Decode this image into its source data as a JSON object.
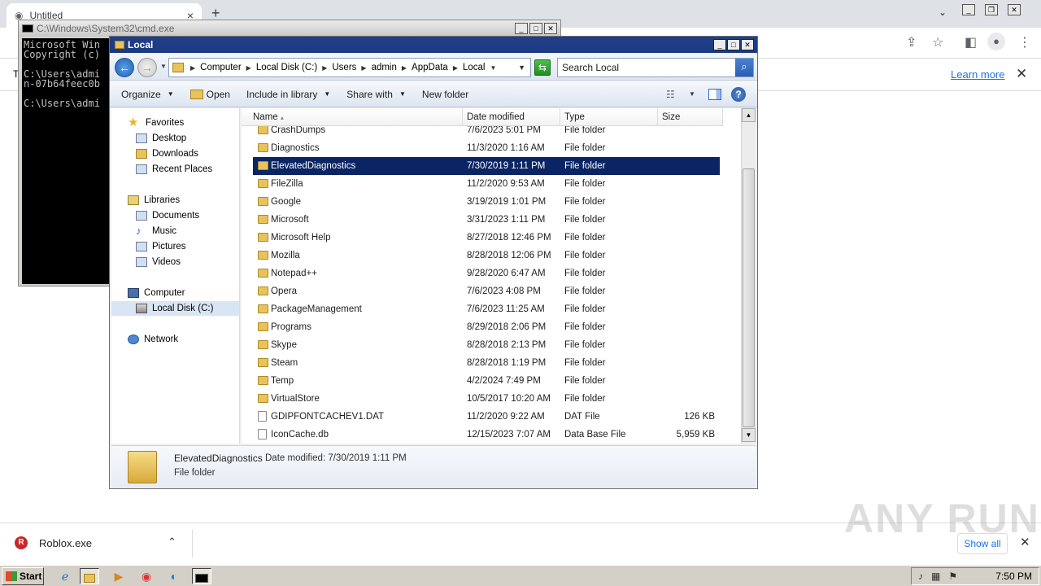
{
  "browser": {
    "tab_title": "Untitled",
    "tab_close": "×",
    "new_tab": "+",
    "infobar_letter": "T",
    "learn_more": "Learn more",
    "close": "✕"
  },
  "cmd": {
    "title": "C:\\Windows\\System32\\cmd.exe",
    "lines": "Microsoft Win\nCopyright (c)\n\nC:\\Users\\admi\nn-07b64feec0b\n\nC:\\Users\\admi"
  },
  "explorer": {
    "title": "Local",
    "breadcrumbs": [
      "Computer",
      "Local Disk (C:)",
      "Users",
      "admin",
      "AppData",
      "Local"
    ],
    "search_placeholder": "Search Local",
    "toolbar": {
      "organize": "Organize",
      "open": "Open",
      "include": "Include in library",
      "share": "Share with",
      "new_folder": "New folder"
    },
    "nav": {
      "favorites": "Favorites",
      "desktop": "Desktop",
      "downloads": "Downloads",
      "recent": "Recent Places",
      "libraries": "Libraries",
      "documents": "Documents",
      "music": "Music",
      "pictures": "Pictures",
      "videos": "Videos",
      "computer": "Computer",
      "local_disk": "Local Disk (C:)",
      "network": "Network"
    },
    "columns": {
      "name": "Name",
      "date": "Date modified",
      "type": "Type",
      "size": "Size"
    },
    "files": [
      {
        "name": "CrashDumps",
        "date": "7/6/2023 5:01 PM",
        "type": "File folder",
        "size": ""
      },
      {
        "name": "Diagnostics",
        "date": "11/3/2020 1:16 AM",
        "type": "File folder",
        "size": ""
      },
      {
        "name": "ElevatedDiagnostics",
        "date": "7/30/2019 1:11 PM",
        "type": "File folder",
        "size": ""
      },
      {
        "name": "FileZilla",
        "date": "11/2/2020 9:53 AM",
        "type": "File folder",
        "size": ""
      },
      {
        "name": "Google",
        "date": "3/19/2019 1:01 PM",
        "type": "File folder",
        "size": ""
      },
      {
        "name": "Microsoft",
        "date": "3/31/2023 1:11 PM",
        "type": "File folder",
        "size": ""
      },
      {
        "name": "Microsoft Help",
        "date": "8/27/2018 12:46 PM",
        "type": "File folder",
        "size": ""
      },
      {
        "name": "Mozilla",
        "date": "8/28/2018 12:06 PM",
        "type": "File folder",
        "size": ""
      },
      {
        "name": "Notepad++",
        "date": "9/28/2020 6:47 AM",
        "type": "File folder",
        "size": ""
      },
      {
        "name": "Opera",
        "date": "7/6/2023 4:08 PM",
        "type": "File folder",
        "size": ""
      },
      {
        "name": "PackageManagement",
        "date": "7/6/2023 11:25 AM",
        "type": "File folder",
        "size": ""
      },
      {
        "name": "Programs",
        "date": "8/29/2018 2:06 PM",
        "type": "File folder",
        "size": ""
      },
      {
        "name": "Skype",
        "date": "8/28/2018 2:13 PM",
        "type": "File folder",
        "size": ""
      },
      {
        "name": "Steam",
        "date": "8/28/2018 1:19 PM",
        "type": "File folder",
        "size": ""
      },
      {
        "name": "Temp",
        "date": "4/2/2024 7:49 PM",
        "type": "File folder",
        "size": ""
      },
      {
        "name": "VirtualStore",
        "date": "10/5/2017 10:20 AM",
        "type": "File folder",
        "size": ""
      },
      {
        "name": "GDIPFONTCACHEV1.DAT",
        "date": "11/2/2020 9:22 AM",
        "type": "DAT File",
        "size": "126 KB"
      },
      {
        "name": "IconCache.db",
        "date": "12/15/2023 7:07 AM",
        "type": "Data Base File",
        "size": "5,959 KB"
      }
    ],
    "selected_index": 2,
    "details": {
      "name": "ElevatedDiagnostics",
      "modified": "Date modified: 7/30/2019 1:11 PM",
      "type": "File folder"
    }
  },
  "downloads": {
    "item": "Roblox.exe",
    "show_all": "Show all"
  },
  "watermark": "ANY RUN",
  "taskbar": {
    "start": "Start",
    "clock": "7:50 PM"
  }
}
